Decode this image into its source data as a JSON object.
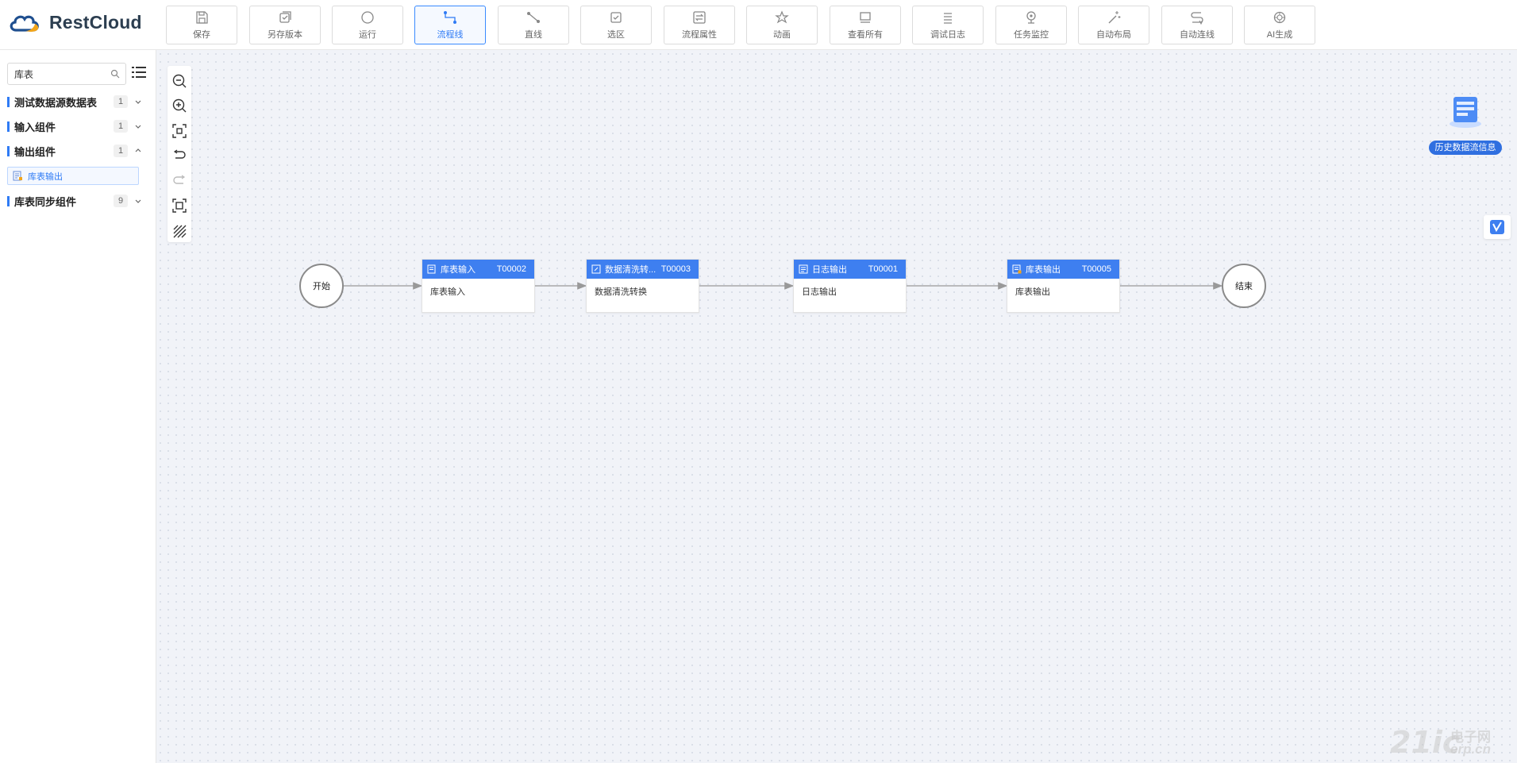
{
  "app": {
    "brand": "RestCloud"
  },
  "toolbar": {
    "items": [
      {
        "label": "保存",
        "icon": "save-icon"
      },
      {
        "label": "另存版本",
        "icon": "save-version-icon"
      },
      {
        "label": "运行",
        "icon": "run-icon"
      },
      {
        "label": "流程线",
        "icon": "flow-line-icon",
        "active": true
      },
      {
        "label": "直线",
        "icon": "straight-line-icon"
      },
      {
        "label": "选区",
        "icon": "select-area-icon"
      },
      {
        "label": "流程属性",
        "icon": "flow-properties-icon"
      },
      {
        "label": "动画",
        "icon": "animation-icon"
      },
      {
        "label": "查看所有",
        "icon": "view-all-icon"
      },
      {
        "label": "调试日志",
        "icon": "debug-log-icon"
      },
      {
        "label": "任务监控",
        "icon": "task-monitor-icon"
      },
      {
        "label": "自动布局",
        "icon": "auto-layout-icon"
      },
      {
        "label": "自动连线",
        "icon": "auto-connect-icon"
      },
      {
        "label": "AI生成",
        "icon": "ai-generate-icon"
      }
    ]
  },
  "sidebar": {
    "search": {
      "value": "库表",
      "placeholder": ""
    },
    "groups": [
      {
        "label": "测试数据源数据表",
        "count": "1",
        "expanded": false
      },
      {
        "label": "输入组件",
        "count": "1",
        "expanded": false
      },
      {
        "label": "输出组件",
        "count": "1",
        "expanded": true
      },
      {
        "label": "库表同步组件",
        "count": "9",
        "expanded": false
      }
    ],
    "subitem": {
      "label": "库表输出"
    }
  },
  "canvas": {
    "start_label": "开始",
    "end_label": "结束",
    "nodes": [
      {
        "title": "库表输入",
        "id": "T00002",
        "body": "库表输入"
      },
      {
        "title": "数据清洗转...",
        "id": "T00003",
        "body": "数据清洗转换"
      },
      {
        "title": "日志输出",
        "id": "T00001",
        "body": "日志输出"
      },
      {
        "title": "库表输出",
        "id": "T00005",
        "body": "库表输出"
      }
    ],
    "history_label": "历史数据流信息"
  },
  "watermark": {
    "big": "21ic",
    "top": "电子网",
    "bottom": "erp.cn"
  },
  "colors": {
    "accent": "#3e7ff0",
    "canvas_bg": "#f1f3f8",
    "active_border": "#3a8bff"
  }
}
